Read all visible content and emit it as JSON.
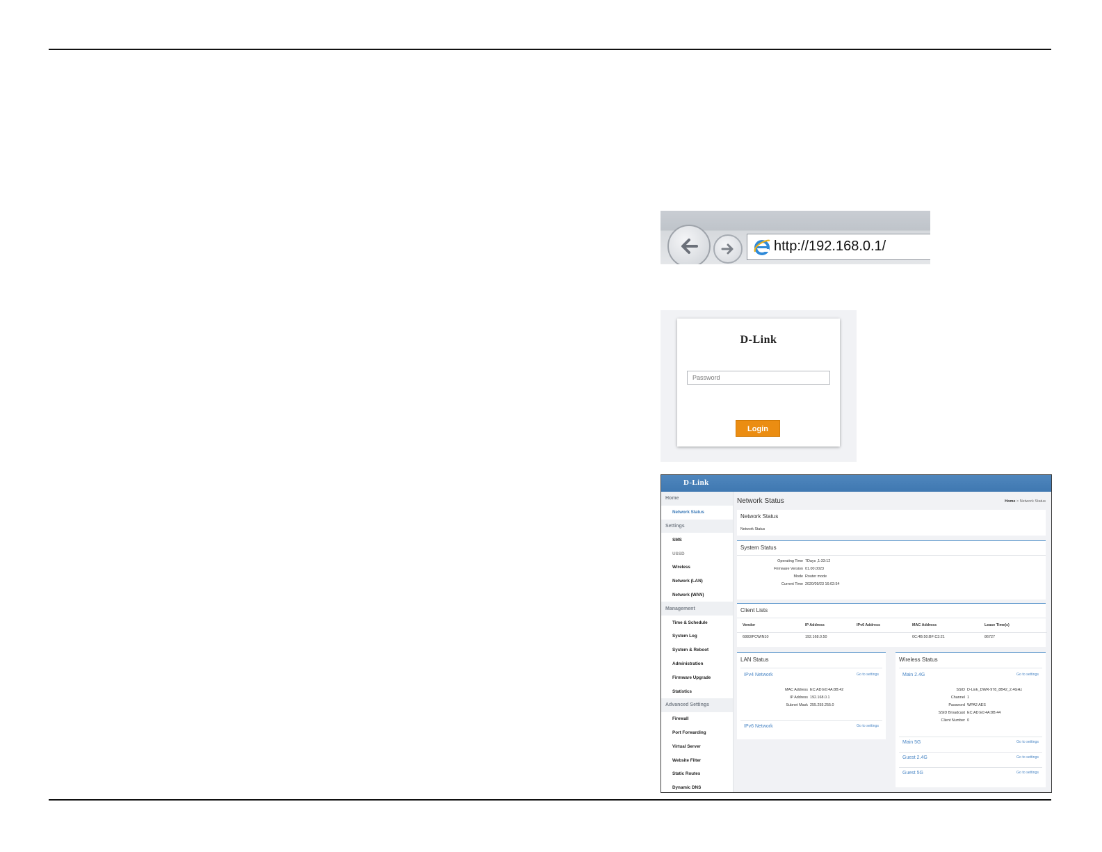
{
  "browser": {
    "url": "http://192.168.0.1/"
  },
  "login": {
    "logo": "D-Link",
    "password_placeholder": "Password",
    "button": "Login"
  },
  "admin": {
    "logo": "D-Link",
    "sidebar": [
      {
        "label": "Home",
        "type": "group"
      },
      {
        "label": "Network Status",
        "type": "child",
        "active": true
      },
      {
        "label": "Settings",
        "type": "group"
      },
      {
        "label": "SMS",
        "type": "child"
      },
      {
        "label": "USSD",
        "type": "child",
        "grey": true
      },
      {
        "label": "Wireless",
        "type": "child"
      },
      {
        "label": "Network (LAN)",
        "type": "child"
      },
      {
        "label": "Network (WAN)",
        "type": "child"
      },
      {
        "label": "Management",
        "type": "group"
      },
      {
        "label": "Time & Schedule",
        "type": "child"
      },
      {
        "label": "System Log",
        "type": "child"
      },
      {
        "label": "System & Reboot",
        "type": "child"
      },
      {
        "label": "Administration",
        "type": "child"
      },
      {
        "label": "Firmware Upgrade",
        "type": "child"
      },
      {
        "label": "Statistics",
        "type": "child"
      },
      {
        "label": "Advanced Settings",
        "type": "group"
      },
      {
        "label": "Firewall",
        "type": "child"
      },
      {
        "label": "Port Forwarding",
        "type": "child"
      },
      {
        "label": "Virtual Server",
        "type": "child"
      },
      {
        "label": "Website Filter",
        "type": "child"
      },
      {
        "label": "Static Routes",
        "type": "child"
      },
      {
        "label": "Dynamic DNS",
        "type": "child"
      }
    ],
    "page_title": "Network Status",
    "breadcrumb": {
      "home": "Home",
      "sep": ">",
      "current": "Network Status"
    },
    "network_status": {
      "title": "Network Status",
      "text": "Network Status"
    },
    "system_status": {
      "title": "System Status",
      "rows": [
        {
          "k": "Operating Time",
          "v": "7Days ,1:33:12"
        },
        {
          "k": "Firmware Version",
          "v": "01.00.0023"
        },
        {
          "k": "Mode",
          "v": "Router mode"
        },
        {
          "k": "Current Time",
          "v": "2020/09/23 16:02:54"
        }
      ]
    },
    "client_lists": {
      "title": "Client Lists",
      "columns": [
        "Vendor",
        "IP Address",
        "IPv6 Address",
        "MAC Address",
        "Lease Time(s)"
      ],
      "rows": [
        [
          "6883IPCWIN10",
          "192.168.0.50",
          "",
          "0C:4B:50:BF:C3:21",
          "86727"
        ]
      ]
    },
    "lan_status": {
      "title": "LAN Status",
      "ipv4_label": "IPv4 Network",
      "ipv6_label": "IPv6 Network",
      "go": "Go to settings",
      "rows": [
        {
          "k": "MAC Address",
          "v": "EC:AD:E0:4A:8B:42"
        },
        {
          "k": "IP Address",
          "v": "192.168.0.1"
        },
        {
          "k": "Subnet Mask",
          "v": "255.255.255.0"
        }
      ]
    },
    "wireless_status": {
      "title": "Wireless Status",
      "main24_label": "Main 2.4G",
      "main5_label": "Main 5G",
      "guest24_label": "Guest 2.4G",
      "guest5_label": "Guest 5G",
      "go": "Go to settings",
      "rows": [
        {
          "k": "SSID",
          "v": "D-Link_DWR-978_8B42_2.4GHz"
        },
        {
          "k": "Channel",
          "v": "1"
        },
        {
          "k": "Password",
          "v": "WPA2 AES"
        },
        {
          "k": "SSID Broadcast",
          "v": "EC:AD:E0:4A:8B:44"
        },
        {
          "k": "Client Number",
          "v": "0"
        }
      ]
    }
  }
}
